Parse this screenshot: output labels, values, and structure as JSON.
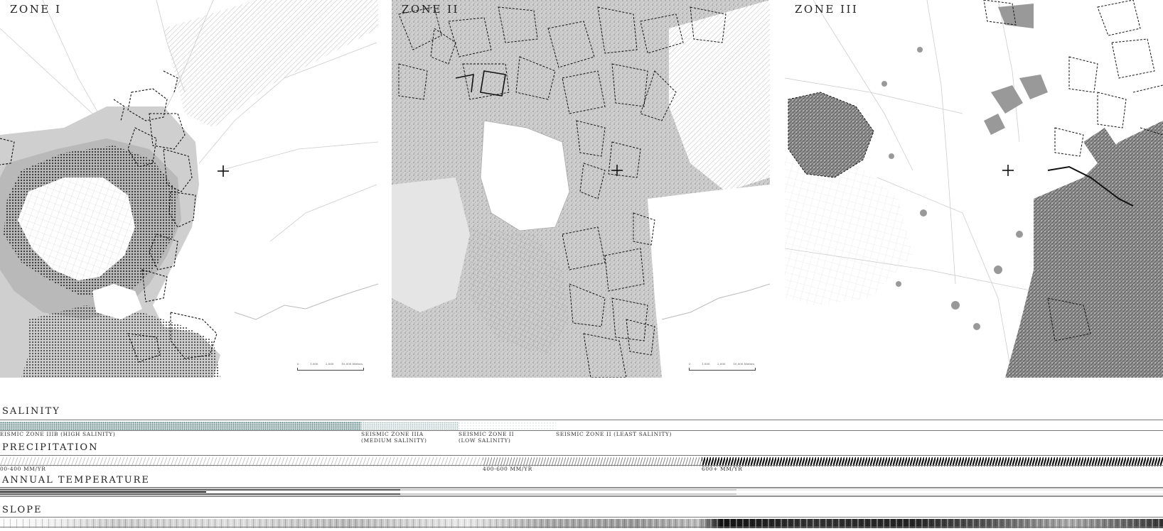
{
  "panels": [
    {
      "title": "ZONE I"
    },
    {
      "title": "ZONE II"
    },
    {
      "title": "ZONE III"
    }
  ],
  "scalebar": {
    "ticks": [
      "0",
      "1,000",
      "2,000",
      "10,000 Meters"
    ]
  },
  "gradients": {
    "salinity": {
      "label": "SALINITY",
      "segments": [
        {
          "label": "EISMIC ZONE IIIB (HIGH SALINITY)",
          "fraction": 0.31
        },
        {
          "label": "SEISMIC ZONE IIIA\n(MEDIUM SALINITY)",
          "fraction": 0.084
        },
        {
          "label": "SEISMIC ZONE II\n(LOW SALINITY)",
          "fraction": 0.084
        },
        {
          "label": "SEISMIC ZONE II (LEAST SALINITY)",
          "fraction": 0.522
        }
      ]
    },
    "precipitation": {
      "label": "PRECIPITATION",
      "segments": [
        {
          "label": "00-400 MM/YR",
          "fraction": 0.415
        },
        {
          "label": "400-600 MM/YR",
          "fraction": 0.189
        },
        {
          "label": "600+ MM/YR",
          "fraction": 0.396
        }
      ]
    },
    "temperature": {
      "label": "ANNUAL TEMPERATURE"
    },
    "slope": {
      "label": "SLOPE"
    }
  },
  "colors": {
    "ink": "#222222",
    "salinity_teal": "#7fa3a3",
    "mid_gray": "#9a9a9a",
    "dark": "#111111"
  }
}
